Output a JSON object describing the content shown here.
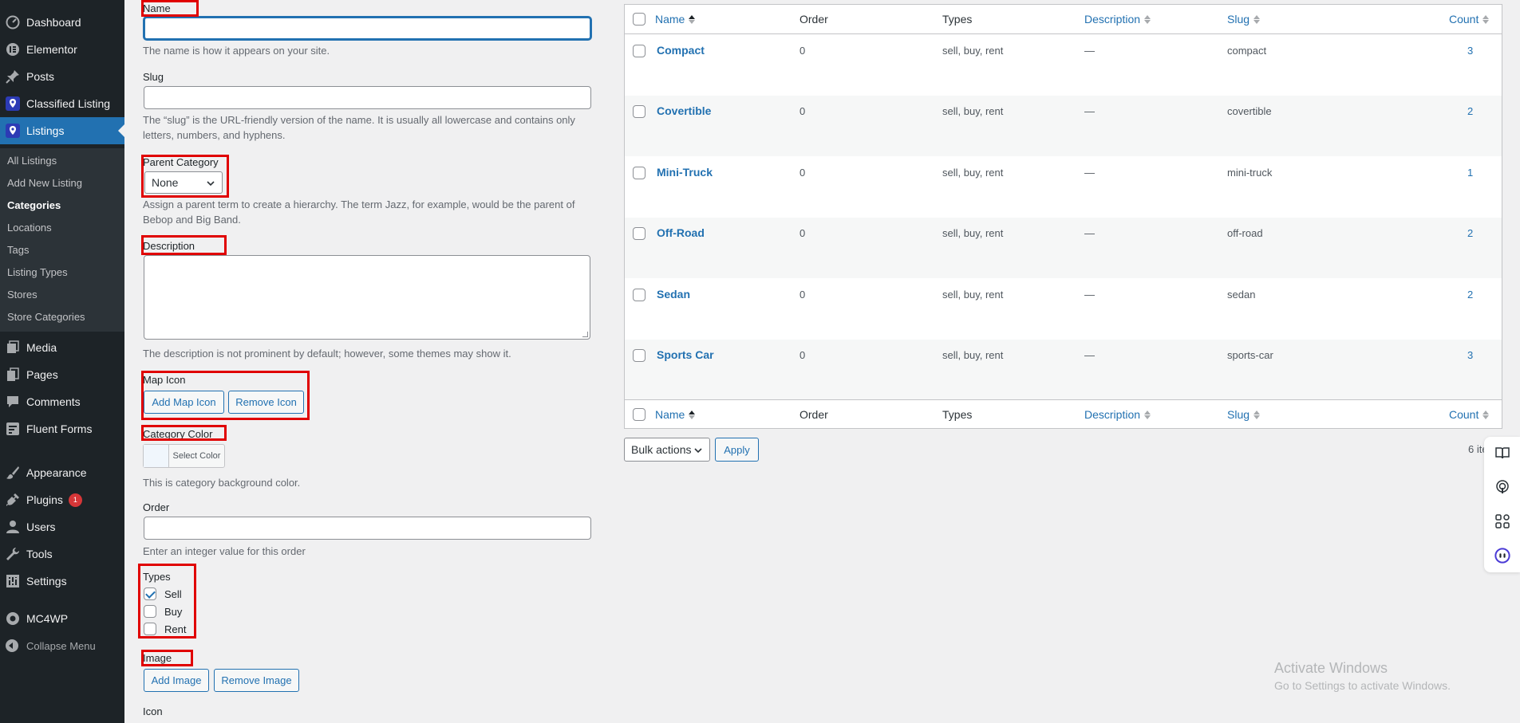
{
  "sidebar": {
    "menu": [
      {
        "label": "Dashboard",
        "icon": "dashboard-icon"
      },
      {
        "label": "Elementor",
        "icon": "elementor-icon"
      },
      {
        "label": "Posts",
        "icon": "pin-icon"
      },
      {
        "label": "Classified Listing",
        "icon": "location-icon"
      },
      {
        "label": "Listings",
        "icon": "location-icon"
      },
      {
        "label": "Media",
        "icon": "media-icon"
      },
      {
        "label": "Pages",
        "icon": "pages-icon"
      },
      {
        "label": "Comments",
        "icon": "comments-icon"
      },
      {
        "label": "Fluent Forms",
        "icon": "forms-icon"
      },
      {
        "label": "Appearance",
        "icon": "brush-icon"
      },
      {
        "label": "Plugins",
        "icon": "plugin-icon",
        "badge": "1"
      },
      {
        "label": "Users",
        "icon": "users-icon"
      },
      {
        "label": "Tools",
        "icon": "wrench-icon"
      },
      {
        "label": "Settings",
        "icon": "settings-icon"
      },
      {
        "label": "MC4WP",
        "icon": "mc4wp-icon"
      },
      {
        "label": "Collapse Menu",
        "icon": "collapse-icon"
      }
    ],
    "submenu": [
      "All Listings",
      "Add New Listing",
      "Categories",
      "Locations",
      "Tags",
      "Listing Types",
      "Stores",
      "Store Categories"
    ],
    "colors": {
      "bg": "#1d2327",
      "active": "#2271b1",
      "submenu_bg": "#2c3338"
    }
  },
  "form": {
    "name_label": "Name",
    "name_help": "The name is how it appears on your site.",
    "slug_label": "Slug",
    "slug_help": "The “slug” is the URL-friendly version of the name. It is usually all lowercase and contains only letters, numbers, and hyphens.",
    "parent_label": "Parent Category",
    "parent_value": "None",
    "parent_help": "Assign a parent term to create a hierarchy. The term Jazz, for example, would be the parent of Bebop and Big Band.",
    "description_label": "Description",
    "description_help": "The description is not prominent by default; however, some themes may show it.",
    "map_icon_label": "Map Icon",
    "add_map_icon": "Add Map Icon",
    "remove_icon": "Remove Icon",
    "category_color_label": "Category Color",
    "select_color": "Select Color",
    "color_help": "This is category background color.",
    "order_label": "Order",
    "order_help": "Enter an integer value for this order",
    "types_label": "Types",
    "types": [
      {
        "label": "Sell",
        "checked": true
      },
      {
        "label": "Buy",
        "checked": false
      },
      {
        "label": "Rent",
        "checked": false
      }
    ],
    "image_label": "Image",
    "add_image": "Add Image",
    "remove_image": "Remove Image",
    "icon_label": "Icon"
  },
  "table": {
    "columns": [
      "Name",
      "Order",
      "Types",
      "Description",
      "Slug",
      "Count"
    ],
    "rows": [
      {
        "name": "Compact",
        "order": "0",
        "types": "sell, buy, rent",
        "description": "—",
        "slug": "compact",
        "count": "3"
      },
      {
        "name": "Covertible",
        "order": "0",
        "types": "sell, buy, rent",
        "description": "—",
        "slug": "covertible",
        "count": "2"
      },
      {
        "name": "Mini-Truck",
        "order": "0",
        "types": "sell, buy, rent",
        "description": "—",
        "slug": "mini-truck",
        "count": "1"
      },
      {
        "name": "Off-Road",
        "order": "0",
        "types": "sell, buy, rent",
        "description": "—",
        "slug": "off-road",
        "count": "2"
      },
      {
        "name": "Sedan",
        "order": "0",
        "types": "sell, buy, rent",
        "description": "—",
        "slug": "sedan",
        "count": "2"
      },
      {
        "name": "Sports Car",
        "order": "0",
        "types": "sell, buy, rent",
        "description": "—",
        "slug": "sports-car",
        "count": "3"
      }
    ],
    "bulk_actions": "Bulk actions",
    "apply": "Apply",
    "items_count": "6 ite"
  },
  "float_icons": [
    "book-icon",
    "podcast-icon",
    "apps-icon",
    "assistant-icon"
  ],
  "watermark": {
    "line1": "Activate Windows",
    "line2": "Go to Settings to activate Windows."
  },
  "accent": "#2271b1",
  "highlight": "#e00000"
}
